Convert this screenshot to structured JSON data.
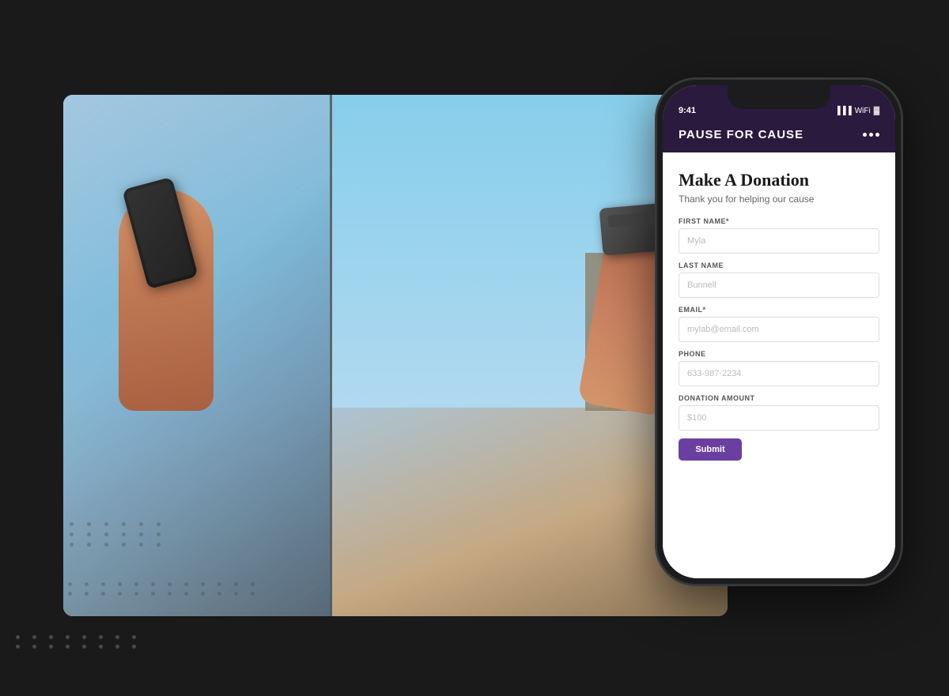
{
  "app": {
    "title": "PAUSE FOR CAUSE",
    "dots": [
      "•",
      "•",
      "•"
    ]
  },
  "status_bar": {
    "time": "9:41",
    "signal": "●●●",
    "wifi": "WiFi",
    "battery": "100%"
  },
  "form": {
    "title": "Make A Donation",
    "subtitle": "Thank you for helping our cause",
    "fields": [
      {
        "label": "FIRST NAME*",
        "placeholder": "Myla"
      },
      {
        "label": "LAST NAME",
        "placeholder": "Bunnell"
      },
      {
        "label": "EMAIL*",
        "placeholder": "mylab@email.com"
      },
      {
        "label": "PHONE",
        "placeholder": "633-987-2234"
      },
      {
        "label": "DONATION AMOUNT",
        "placeholder": "$100"
      }
    ],
    "submit_label": "Submit"
  },
  "colors": {
    "header_bg": "#2a1a3e",
    "submit_bg": "#6b3fa0",
    "phone_bg": "#1c1c1e"
  }
}
